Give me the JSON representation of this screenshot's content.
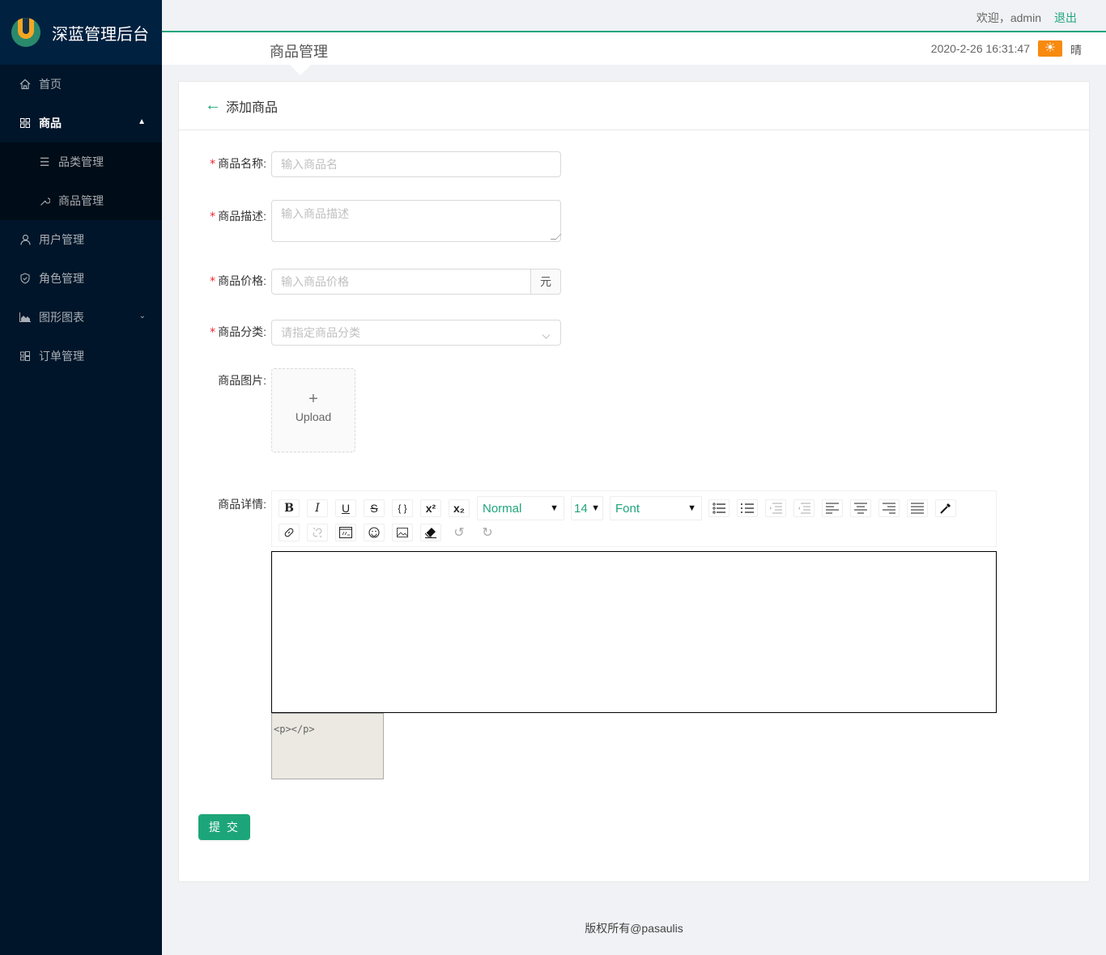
{
  "app": {
    "title": "深蓝管理后台"
  },
  "sidebar": {
    "items": [
      {
        "label": "首页",
        "icon": "home-icon"
      },
      {
        "label": "商品",
        "icon": "appstore-icon",
        "expanded": true,
        "children": [
          {
            "label": "品类管理",
            "icon": "bars-icon"
          },
          {
            "label": "商品管理",
            "icon": "tool-icon"
          }
        ]
      },
      {
        "label": "用户管理",
        "icon": "user-icon"
      },
      {
        "label": "角色管理",
        "icon": "safety-icon"
      },
      {
        "label": "图形图表",
        "icon": "area-chart-icon",
        "expanded": false
      },
      {
        "label": "订单管理",
        "icon": "windows-icon"
      }
    ]
  },
  "header": {
    "welcome": "欢迎，admin",
    "logout": "退出",
    "page_title": "商品管理",
    "datetime": "2020-2-26 16:31:47",
    "weather_icon": "sun-icon",
    "weather": "晴"
  },
  "card": {
    "title": "添加商品",
    "form": {
      "name": {
        "label": "商品名称:",
        "placeholder": "输入商品名",
        "value": ""
      },
      "desc": {
        "label": "商品描述:",
        "placeholder": "输入商品描述",
        "value": ""
      },
      "price": {
        "label": "商品价格:",
        "placeholder": "输入商品价格",
        "addon": "元",
        "value": ""
      },
      "category": {
        "label": "商品分类:",
        "placeholder": "请指定商品分类"
      },
      "images": {
        "label": "商品图片:",
        "upload_text": "Upload"
      },
      "detail": {
        "label": "商品详情:"
      }
    },
    "editor": {
      "toolbar_row1": [
        "B",
        "I",
        "U",
        "S",
        "{ }",
        "x²",
        "x₂"
      ],
      "block_type": "Normal",
      "font_size": "14",
      "font_family": "Font",
      "source_html": "<p></p>"
    },
    "submit": "提 交"
  },
  "footer": {
    "text": "版权所有@pasaulis"
  }
}
